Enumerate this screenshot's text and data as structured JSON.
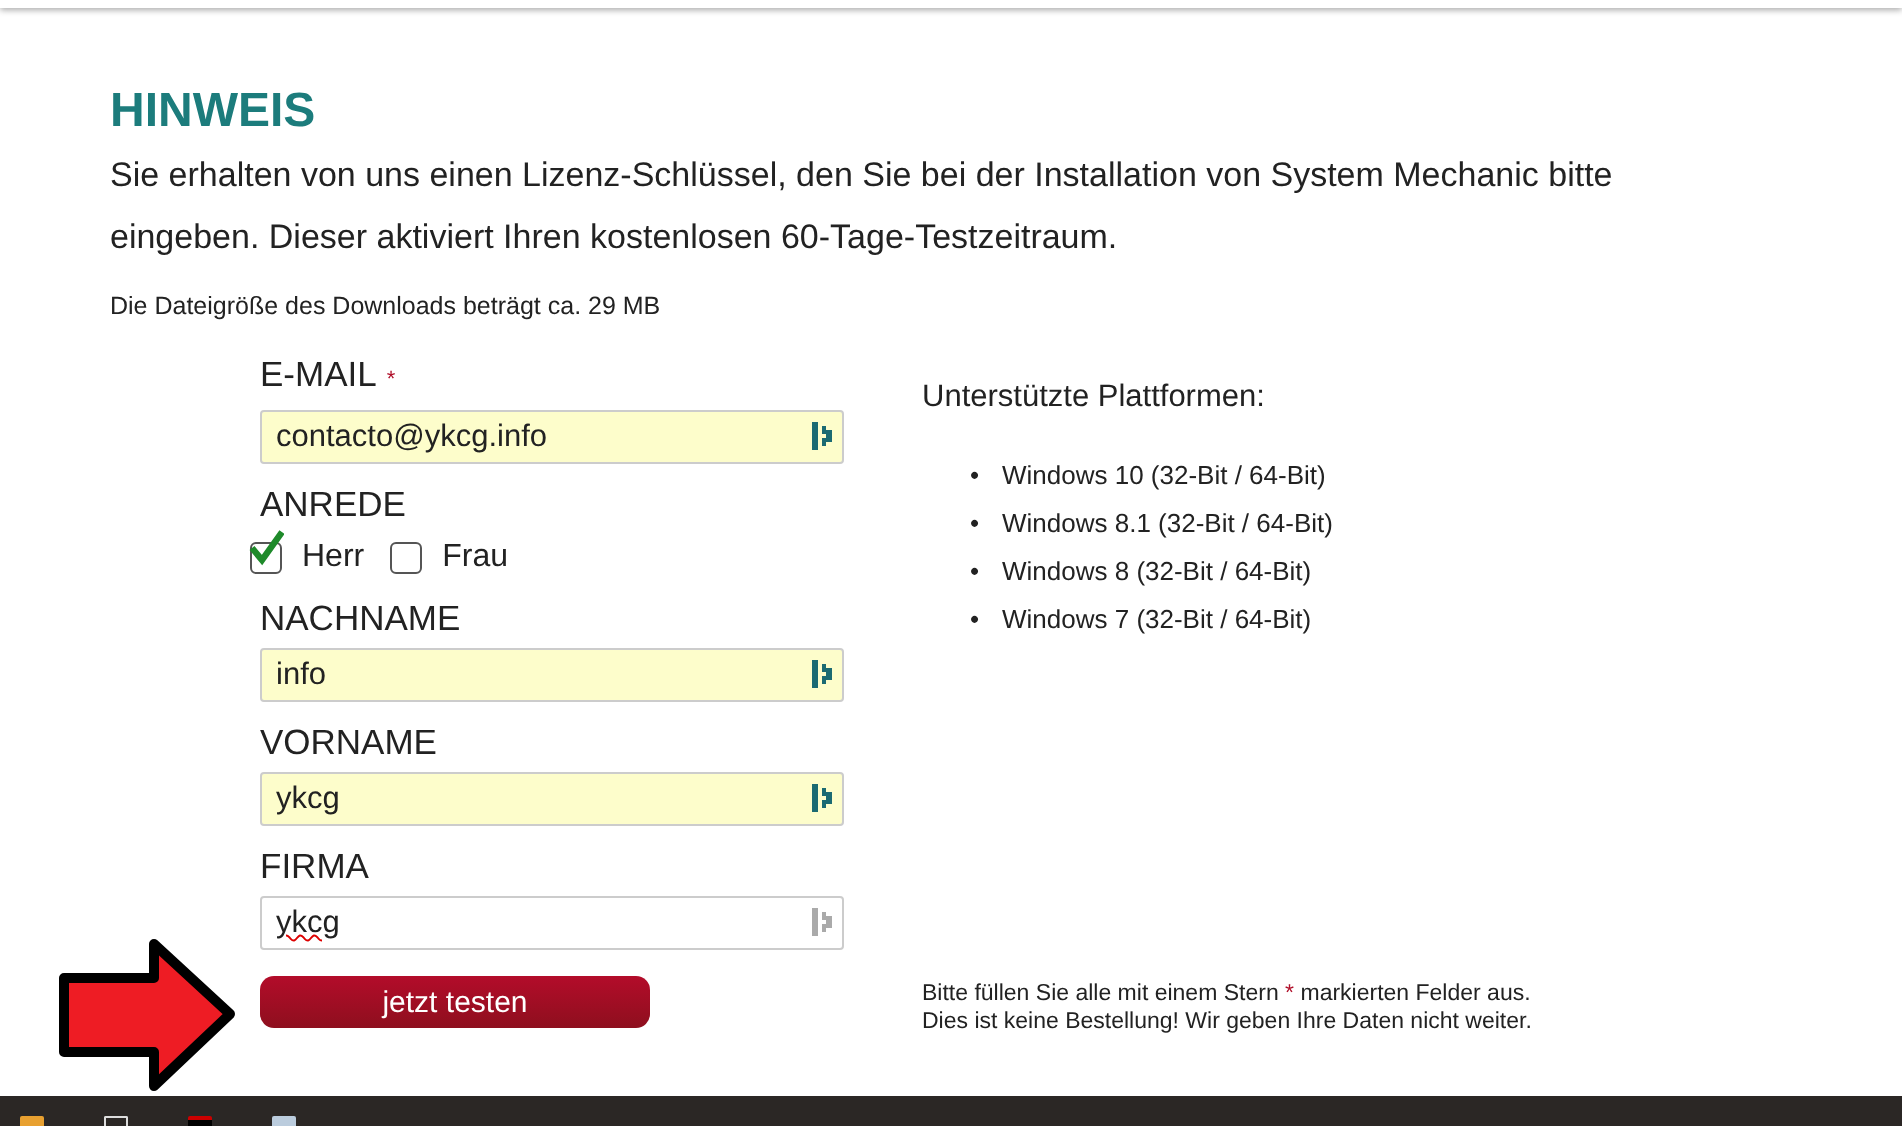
{
  "notice": {
    "title": "HINWEIS",
    "text": "Sie erhalten von uns einen Lizenz-Schlüssel, den Sie bei der Installation von System Mechanic bitte eingeben. Dieser aktiviert Ihren kostenlosen 60-Tage-Testzeitraum.",
    "download_size": "Die Dateigröße des Downloads beträgt ca. 29 MB"
  },
  "form": {
    "fields": [
      {
        "kind": "input",
        "label": "E-MAIL",
        "required_mark": "*",
        "value": "contacto@ykcg.info",
        "autofilled": true,
        "misspelled": false
      },
      {
        "kind": "radio",
        "label": "ANREDE",
        "options": [
          {
            "label": "Herr",
            "checked": true
          },
          {
            "label": "Frau",
            "checked": false
          }
        ]
      },
      {
        "kind": "input",
        "label": "NACHNAME",
        "value": "info",
        "autofilled": true,
        "misspelled": false
      },
      {
        "kind": "input",
        "label": "VORNAME",
        "value": "ykcg",
        "autofilled": true,
        "misspelled": false
      },
      {
        "kind": "input",
        "label": "FIRMA",
        "value": "ykcg",
        "autofilled": false,
        "misspelled": true
      }
    ],
    "submit": "jetzt testen"
  },
  "platforms": {
    "title": "Unterstützte Plattformen:",
    "items": [
      {
        "marker": "•",
        "text": "Windows 10 (32-Bit / 64-Bit)"
      },
      {
        "marker": "•",
        "text": "Windows 8.1 (32-Bit / 64-Bit)"
      },
      {
        "marker": "•",
        "text": "Windows 8 (32-Bit / 64-Bit)"
      },
      {
        "marker": "•",
        "text": "Windows 7 (32-Bit / 64-Bit)"
      }
    ]
  },
  "note": {
    "line_1_before": "Bitte füllen Sie alle mit einem Stern",
    "star": "*",
    "line_1_after": "markierten Felder aus.",
    "line_2": "Dies ist keine Bestellung! Wir geben Ihre Daten nicht weiter."
  }
}
